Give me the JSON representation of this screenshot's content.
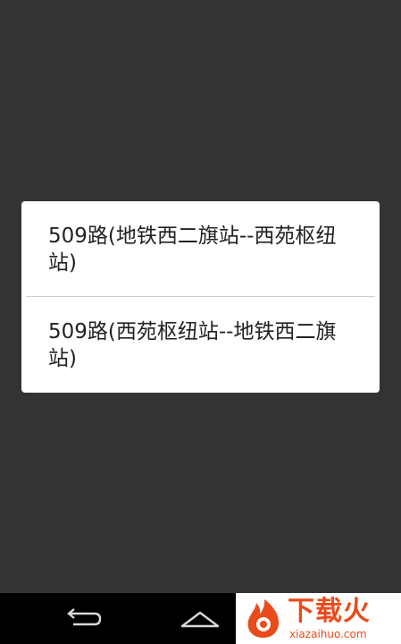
{
  "dialog": {
    "options": [
      {
        "label": "509路(地铁西二旗站--西苑枢纽站)"
      },
      {
        "label": "509路(西苑枢纽站--地铁西二旗站)"
      }
    ]
  },
  "navigation_bar": {
    "buttons": [
      {
        "icon": "back-icon"
      },
      {
        "icon": "home-icon"
      }
    ]
  },
  "watermark": {
    "title": "下载火",
    "url": "xiazaihuo.com"
  },
  "colors": {
    "background": "#333333",
    "dialog_background": "#ffffff",
    "text": "#222222",
    "navbar": "#000000",
    "watermark_accent": "#ea4b1b"
  }
}
